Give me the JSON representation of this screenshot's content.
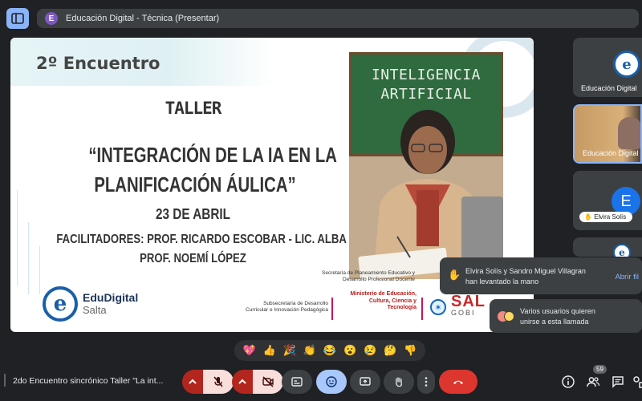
{
  "presentation": {
    "avatar_letter": "E",
    "title": "Educación Digital - Técnica (Presentar)"
  },
  "slide": {
    "encuentro": "2º Encuentro",
    "taller": "TALLER",
    "title_line1": "“INTEGRACIÓN DE LA IA EN LA",
    "title_line2": "PLANIFICACIÓN ÁULICA”",
    "date": "23 DE ABRIL",
    "facilitators_line1": "FACILITADORES: PROF. RICARDO ESCOBAR - LIC. ALBA RIOJA -",
    "facilitators_line2": "PROF. NOEMÍ LÓPEZ",
    "logo_name": "EduDigital",
    "logo_city": "Salta",
    "chalk_line1": "INTELIGENCIA",
    "chalk_line2": "ARTIFICIAL",
    "subsecretaria": "Subsecretaría de Desarrollo Curricular e Innovación Pedagógica",
    "secretaria": "Secretaría de Planeamiento Educativo y Desarrollo Profesional Docente",
    "ministerio": "Ministerio de Educación, Cultura, Ciencia y Tecnología",
    "salta_name": "SAL",
    "salta_gob": "GOBI"
  },
  "tiles": [
    {
      "label": "Educación Digital"
    },
    {
      "label": "Educación Digital"
    },
    {
      "avatar": "E",
      "name": "Elvira Solís"
    }
  ],
  "notifications": {
    "hands_text_1": "Elvira Solís y Sandro Miguel Villagran",
    "hands_text_2": "han levantado la mano",
    "hands_link": "Abrir fil",
    "join_text_1": "Varios usuarios quieren",
    "join_text_2": "unirse a esta llamada"
  },
  "reactions": [
    "💖",
    "👍",
    "🎉",
    "👏",
    "😂",
    "😮",
    "😢",
    "🤔",
    "👎"
  ],
  "bottom": {
    "meeting_title": "2do Encuentro sincrónico Taller \"La int...",
    "participants_count": "59"
  },
  "colors": {
    "accent_blue": "#8ab4f8",
    "hangup_red": "#dc362e",
    "brand_blue": "#1a5fa8"
  }
}
